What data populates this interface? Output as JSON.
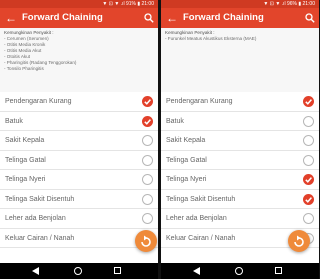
{
  "colors": {
    "accent": "#e2452b",
    "status": "#cf3a22",
    "fab": "#ef8a3a",
    "check_on": "#e2402a"
  },
  "screens": [
    {
      "status_text": "▼ ⊡ ▼ .ıl 91% ▮ 21:00",
      "app_title": "Forward Chaining",
      "summary_head": "Kemungkinan Penyakit :",
      "summary_items": [
        "- Cerumen (Serumen)",
        "- Otitis Media Kronik",
        "- Otitis Media Akut",
        "- Otoitis Akut",
        "- Pharingitis (Radang Tenggorokan)",
        "- Tonsilo Pharingitis"
      ],
      "items": [
        {
          "label": "Pendengaran Kurang",
          "checked": true
        },
        {
          "label": "Batuk",
          "checked": true
        },
        {
          "label": "Sakit Kepala",
          "checked": false
        },
        {
          "label": "Telinga Gatal",
          "checked": false
        },
        {
          "label": "Telinga Nyeri",
          "checked": false
        },
        {
          "label": "Telinga Sakit Disentuh",
          "checked": false
        },
        {
          "label": "Leher ada Benjolan",
          "checked": false
        },
        {
          "label": "Keluar Cairan / Nanah",
          "checked": false
        }
      ]
    },
    {
      "status_text": "▼ ⊡ ▼ .ıl 96% ▮ 21:00",
      "app_title": "Forward Chaining",
      "summary_head": "Kemungkinan Penyakit :",
      "summary_items": [
        "- Furunkel Meatus Akustikus Eksterna (MAE)",
        "",
        "",
        "",
        "",
        ""
      ],
      "items": [
        {
          "label": "Pendengaran Kurang",
          "checked": true
        },
        {
          "label": "Batuk",
          "checked": false
        },
        {
          "label": "Sakit Kepala",
          "checked": false
        },
        {
          "label": "Telinga Gatal",
          "checked": false
        },
        {
          "label": "Telinga Nyeri",
          "checked": true
        },
        {
          "label": "Telinga Sakit Disentuh",
          "checked": true
        },
        {
          "label": "Leher ada Benjolan",
          "checked": false
        },
        {
          "label": "Keluar Cairan / Nanah",
          "checked": false
        }
      ]
    }
  ]
}
